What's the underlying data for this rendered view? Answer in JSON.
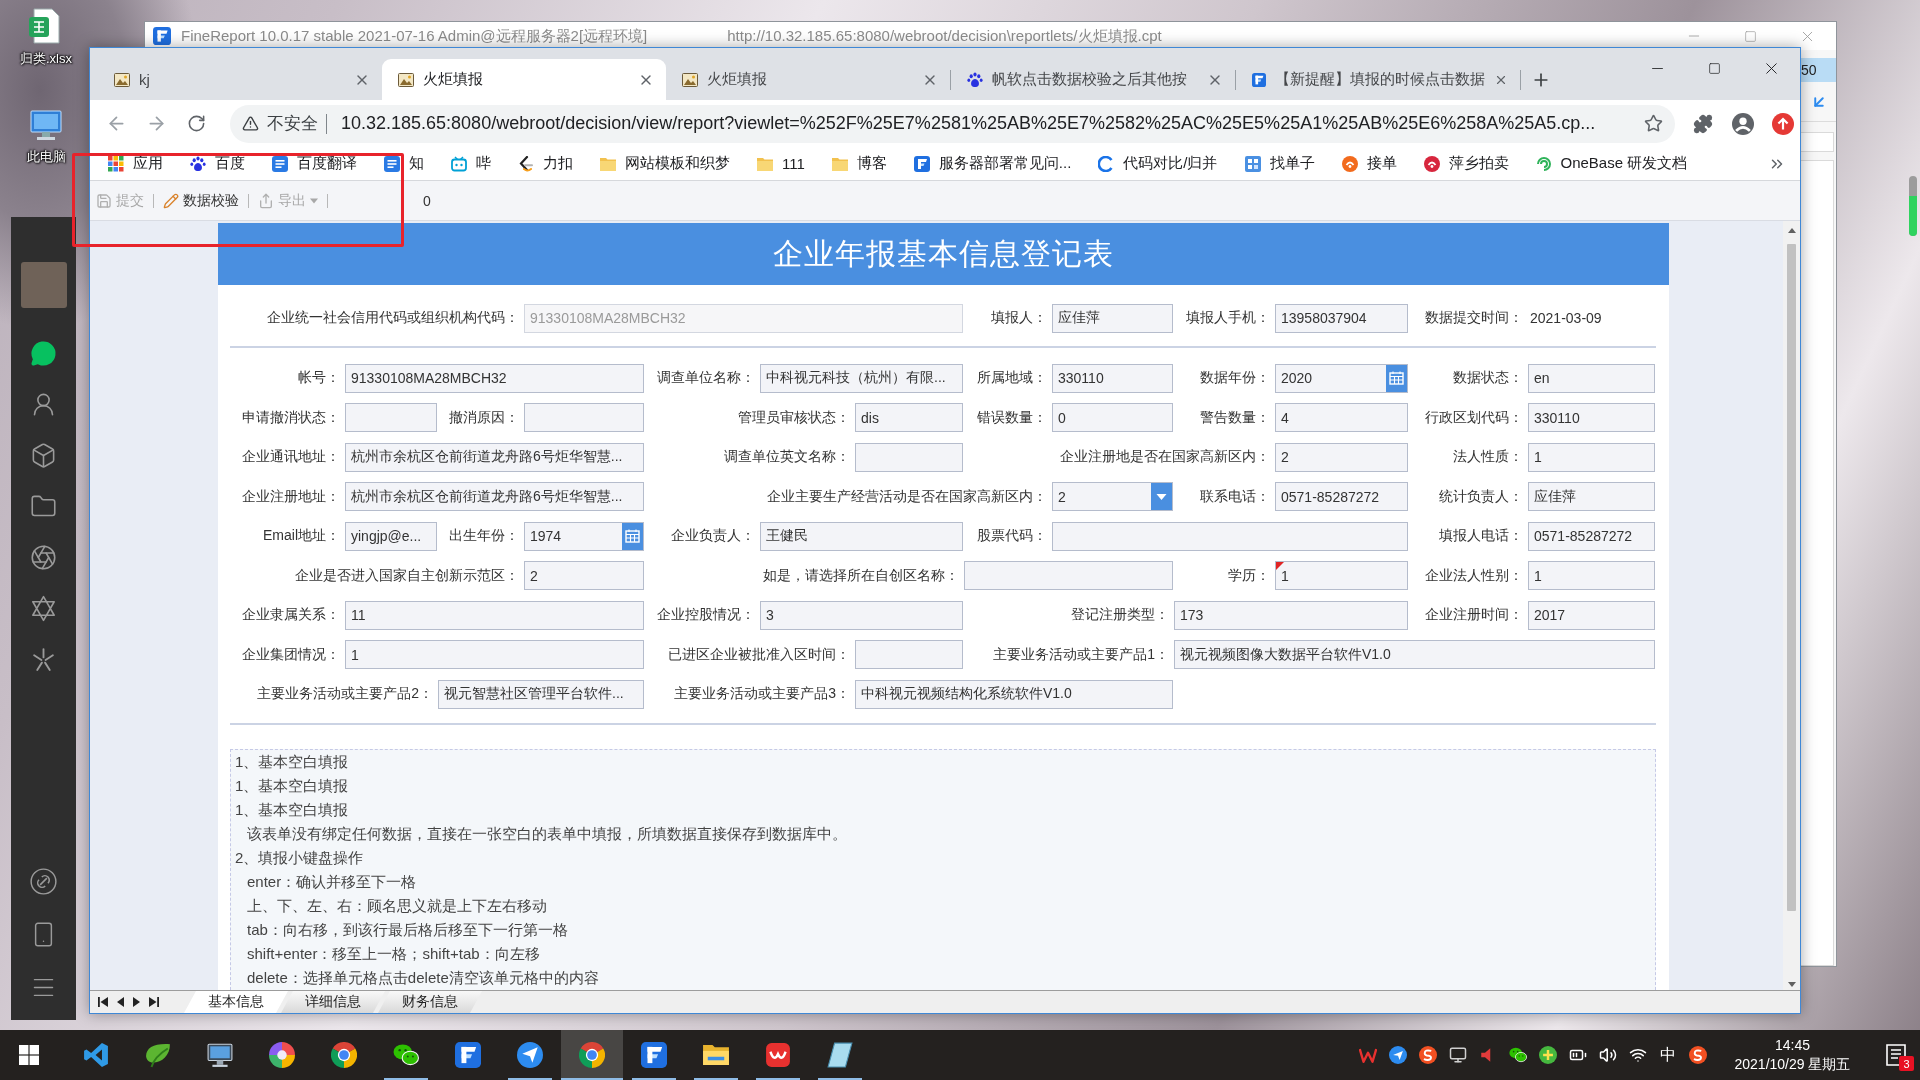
{
  "desktop": {
    "icons": [
      {
        "label": "归类.xlsx"
      },
      {
        "label": "此电脑"
      }
    ]
  },
  "background_window": {
    "title": "FineReport 10.0.17 stable 2021-07-16 Admin@远程服务器2[远程环境]",
    "path": "http://10.32.185.65:8080/webroot/decision\\reportlets/火炬填报.cpt",
    "edge_label": "50"
  },
  "browser": {
    "tabs": [
      {
        "title": "kj",
        "selected": false
      },
      {
        "title": "火炬填报",
        "selected": true
      },
      {
        "title": "火炬填报",
        "selected": false
      },
      {
        "title": "帆软点击数据校验之后其他按",
        "selected": false
      },
      {
        "title": "【新提醒】填报的时候点击数据",
        "selected": false
      }
    ],
    "address_bar": {
      "security_label": "不安全",
      "url": "10.32.185.65:8080/webroot/decision/view/report?viewlet=%252F%25E7%2581%25AB%25E7%2582%25AC%25E5%25A1%25AB%25E6%258A%25A5.cp..."
    },
    "bookmarks": [
      {
        "label": "应用"
      },
      {
        "label": "百度"
      },
      {
        "label": "百度翻译"
      },
      {
        "label": "知"
      },
      {
        "label": "哔"
      },
      {
        "label": "力扣"
      },
      {
        "label": "网站模板和织梦"
      },
      {
        "label": "111"
      },
      {
        "label": "博客"
      },
      {
        "label": "服务器部署常见问..."
      },
      {
        "label": "代码对比/归并"
      },
      {
        "label": "找单子"
      },
      {
        "label": "接单"
      },
      {
        "label": "萍乡拍卖"
      },
      {
        "label": "OneBase 研发文档"
      }
    ],
    "report_toolbar": {
      "buttons": [
        {
          "label": "提交",
          "kind": "button",
          "disabled": true
        },
        {
          "label": "数据校验",
          "kind": "button",
          "disabled": false
        },
        {
          "label": "导出",
          "kind": "menu",
          "disabled": true
        }
      ],
      "counter": "0"
    },
    "report": {
      "title": "企业年报基本信息登记表",
      "header_row": [
        {
          "label": "企业统一社会信用代码或组织机构代码：",
          "value": "91330108MA28MBCH32",
          "kind": "readonly",
          "flagged": false
        },
        {
          "label": "填报人：",
          "value": "应佳萍",
          "kind": "text",
          "flagged": false
        },
        {
          "label": "填报人手机：",
          "value": "13958037904",
          "kind": "text",
          "flagged": false
        },
        {
          "label": "数据提交时间：",
          "value": "2021-03-09",
          "kind": "static",
          "flagged": false
        }
      ],
      "rows": [
        [
          {
            "label": "帐号：",
            "value": "91330108MA28MBCH32",
            "kind": "text",
            "flagged": false
          },
          {
            "label": "调查单位名称：",
            "value": "中科视元科技（杭州）有限...",
            "kind": "text",
            "flagged": false
          },
          {
            "label": "所属地域：",
            "value": "330110",
            "kind": "text",
            "flagged": false
          },
          {
            "label": "数据年份：",
            "value": "2020",
            "kind": "date",
            "flagged": false
          },
          {
            "label": "数据状态：",
            "value": "en",
            "kind": "text",
            "flagged": false
          }
        ],
        [
          {
            "label": "申请撤消状态：",
            "kind": "text",
            "flagged": false
          },
          {
            "label": "撤消原因：",
            "kind": "text",
            "flagged": false
          },
          {
            "label": "管理员审核状态：",
            "value": "dis",
            "kind": "text",
            "flagged": false
          },
          {
            "label": "错误数量：",
            "value": "0",
            "kind": "text",
            "flagged": false
          },
          {
            "label": "警告数量：",
            "value": "4",
            "kind": "text",
            "flagged": false
          },
          {
            "label": "行政区划代码：",
            "value": "330110",
            "kind": "text",
            "flagged": false
          }
        ],
        [
          {
            "label": "企业通讯地址：",
            "value": "杭州市余杭区仓前街道龙舟路6号炬华智慧...",
            "kind": "text",
            "flagged": false
          },
          {
            "label": "调查单位英文名称：",
            "kind": "text",
            "flagged": false
          },
          {
            "label": "企业注册地是否在国家高新区内：",
            "value": "2",
            "kind": "text",
            "flagged": false
          },
          {
            "label": "法人性质：",
            "value": "1",
            "kind": "text",
            "flagged": false
          }
        ],
        [
          {
            "label": "企业注册地址：",
            "value": "杭州市余杭区仓前街道龙舟路6号炬华智慧...",
            "kind": "text",
            "flagged": false
          },
          {
            "label": "企业主要生产经营活动是否在国家高新区内：",
            "value": "2",
            "kind": "select",
            "flagged": false
          },
          {
            "label": "联系电话：",
            "value": "0571-85287272",
            "kind": "text",
            "flagged": false
          },
          {
            "label": "统计负责人：",
            "value": "应佳萍",
            "kind": "text",
            "flagged": false
          }
        ],
        [
          {
            "label": "Email地址：",
            "value": "yingjp@e...",
            "kind": "text",
            "flagged": false
          },
          {
            "label": "出生年份：",
            "value": "1974",
            "kind": "date",
            "flagged": false
          },
          {
            "label": "企业负责人：",
            "value": "王健民",
            "kind": "text",
            "flagged": false
          },
          {
            "label": "股票代码：",
            "kind": "text",
            "flagged": false
          },
          {
            "label": "填报人电话：",
            "value": "0571-85287272",
            "kind": "text",
            "flagged": false
          }
        ],
        [
          {
            "label": "企业是否进入国家自主创新示范区：",
            "value": "2",
            "kind": "text",
            "flagged": false
          },
          {
            "label": "如是，请选择所在自创区名称：",
            "kind": "text",
            "flagged": false
          },
          {
            "label": "学历：",
            "value": "1",
            "kind": "text",
            "flagged": true
          },
          {
            "label": "企业法人性别：",
            "value": "1",
            "kind": "text",
            "flagged": false
          }
        ],
        [
          {
            "label": "企业隶属关系：",
            "value": "11",
            "kind": "text",
            "flagged": false
          },
          {
            "label": "企业控股情况：",
            "value": "3",
            "kind": "text",
            "flagged": false
          },
          {
            "label": "登记注册类型：",
            "value": "173",
            "kind": "text",
            "flagged": false
          },
          {
            "label": "企业注册时间：",
            "value": "2017",
            "kind": "text",
            "flagged": false
          }
        ],
        [
          {
            "label": "企业集团情况：",
            "value": "1",
            "kind": "text",
            "flagged": false
          },
          {
            "label": "已进区企业被批准入区时间：",
            "kind": "text",
            "flagged": false
          },
          {
            "label": "主要业务活动或主要产品1：",
            "value": "视元视频图像大数据平台软件V1.0",
            "kind": "text",
            "flagged": false
          }
        ],
        [
          {
            "label": "主要业务活动或主要产品2：",
            "value": "视元智慧社区管理平台软件...",
            "kind": "text",
            "flagged": false
          },
          {
            "label": "主要业务活动或主要产品3：",
            "value": "中科视元视频结构化系统软件V1.0",
            "kind": "text",
            "flagged": false
          }
        ]
      ],
      "notes": [
        {
          "text": "1、基本空白填报"
        },
        {
          "text": "1、基本空白填报"
        },
        {
          "text": "1、基本空白填报",
          "children": [
            {
              "text": "该表单没有绑定任何数据，直接在一张空白的表单中填报，所填数据直接保存到数据库中。"
            }
          ]
        },
        {
          "text": "2、填报小键盘操作",
          "children": [
            {
              "text": "enter：确认并移至下一格"
            },
            {
              "text": "上、下、左、右：顾名思义就是上下左右移动"
            },
            {
              "text": "tab：向右移，到该行最后格后移至下一行第一格"
            },
            {
              "text": "shift+enter：移至上一格；shift+tab：向左移"
            },
            {
              "text": "delete：选择单元格点击delete清空该单元格中的内容"
            }
          ]
        }
      ]
    },
    "sheet_tabs": [
      {
        "label": "基本信息",
        "selected": true
      },
      {
        "label": "详细信息",
        "selected": false
      },
      {
        "label": "财务信息",
        "selected": false
      }
    ]
  },
  "wechat_sidebar": {
    "nav_items": [
      {
        "selected": true
      },
      {
        "selected": false
      },
      {
        "selected": false
      },
      {
        "selected": false
      },
      {
        "selected": false
      },
      {
        "selected": false
      },
      {
        "selected": false
      }
    ]
  },
  "taskbar": {
    "apps": [
      {
        "running": false,
        "selected": false
      },
      {
        "running": false,
        "selected": false
      },
      {
        "running": false,
        "selected": false
      },
      {
        "running": false,
        "selected": false
      },
      {
        "running": false,
        "selected": false
      },
      {
        "running": true,
        "selected": false
      },
      {
        "running": false,
        "selected": false
      },
      {
        "running": true,
        "selected": false
      },
      {
        "running": true,
        "selected": true
      },
      {
        "running": true,
        "selected": false
      },
      {
        "running": true,
        "selected": false
      },
      {
        "running": true,
        "selected": false
      },
      {
        "running": true,
        "selected": false
      }
    ],
    "input_method": "中",
    "time": "14:45",
    "date": "2021/10/29 星期五",
    "notification_count": "3"
  }
}
